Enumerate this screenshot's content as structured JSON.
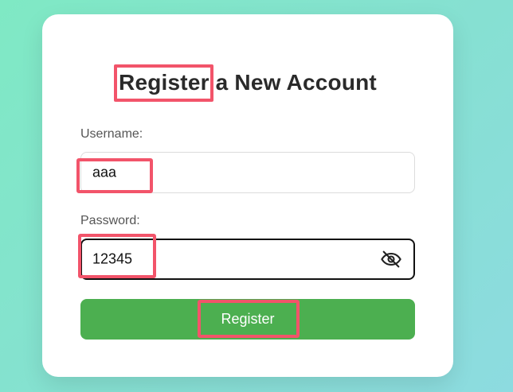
{
  "form": {
    "title_prefix": "Register",
    "title_suffix": " a New Account",
    "username_label": "Username:",
    "username_value": "aaa",
    "password_label": "Password:",
    "password_value": "12345",
    "password_toggle_icon": "eye-off-icon",
    "submit_label": "Register"
  },
  "colors": {
    "accent": "#4caf50",
    "highlight": "#f2546a",
    "background_start": "#7fe9c4",
    "background_end": "#8ddbe0"
  }
}
